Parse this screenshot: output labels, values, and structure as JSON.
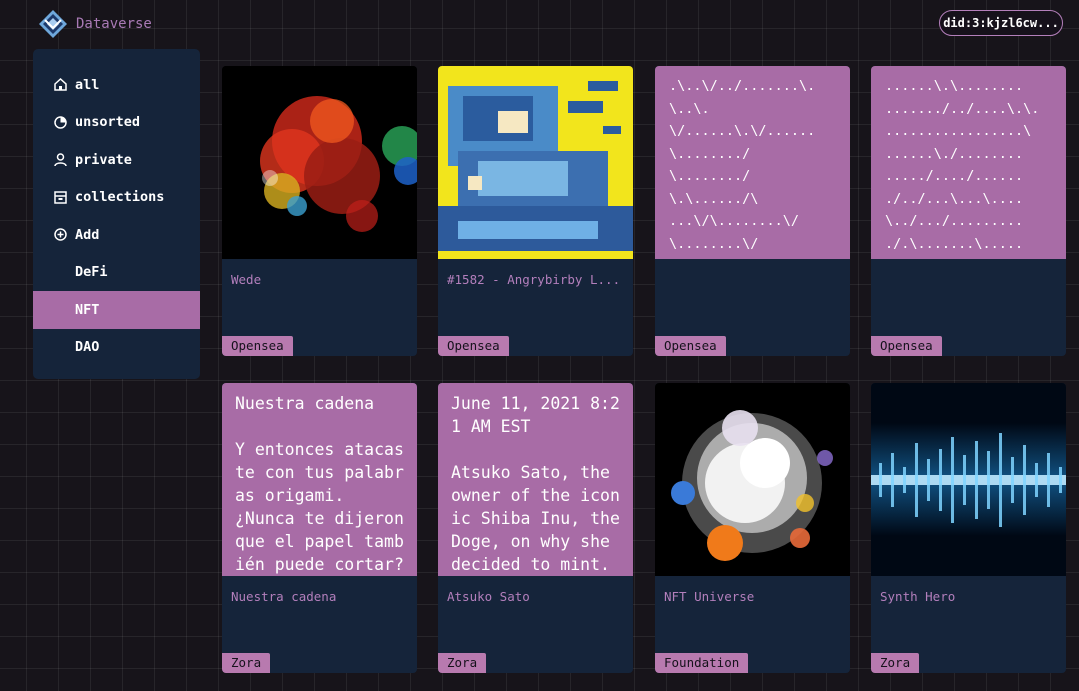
{
  "app": {
    "title": "Dataverse"
  },
  "header": {
    "did": "did:3:kjzl6cw..."
  },
  "sidebar": {
    "items": [
      {
        "label": "all",
        "icon": "home-icon"
      },
      {
        "label": "unsorted",
        "icon": "pie-icon"
      },
      {
        "label": "private",
        "icon": "user-icon"
      },
      {
        "label": "collections",
        "icon": "archive-icon"
      },
      {
        "label": "Add",
        "icon": "plus-circle-icon"
      }
    ],
    "folders": [
      {
        "label": "DeFi",
        "active": false
      },
      {
        "label": "NFT",
        "active": true
      },
      {
        "label": "DAO",
        "active": false
      }
    ]
  },
  "cards": [
    {
      "title": "Wede",
      "tag": "Opensea",
      "kind": "image"
    },
    {
      "title": "#1582 - Angrybirby L...",
      "tag": "Opensea",
      "kind": "image"
    },
    {
      "title": "",
      "tag": "Opensea",
      "kind": "ascii",
      "text": ".\\..\\/../.......\\.\n\\..\\.\n\\/......\\.\\/......\n\\......../\n\\......../\n\\.\\....../\\\n...\\/\\........\\/\n\\........\\/"
    },
    {
      "title": "",
      "tag": "Opensea",
      "kind": "ascii",
      "text": "......\\.\\........\n......./../....\\.\\.\n.................\\\n......\\./........\n...../..../......\n./../...\\...\\....\n\\../.../.........\n./.\\.......\\....."
    },
    {
      "title": "Nuestra cadena",
      "tag": "Zora",
      "kind": "text",
      "text": "Nuestra cadena\n\nY entonces atacas\nte con tus palabr\nas origami.\n¿Nunca te dijeron\nque el papel tamb\nién puede cortar?"
    },
    {
      "title": "Atsuko Sato",
      "tag": "Zora",
      "kind": "text",
      "text": "June 11, 2021 8:2\n1 AM EST\n\nAtsuko Sato, the\nowner of the icon\nic Shiba Inu, the\nDoge, on why she\ndecided to mint."
    },
    {
      "title": "NFT Universe",
      "tag": "Foundation",
      "kind": "image"
    },
    {
      "title": "Synth Hero",
      "tag": "Zora",
      "kind": "image"
    }
  ],
  "colors": {
    "accent": "#a86ca6",
    "panel": "#15243a",
    "background": "#17141a"
  }
}
